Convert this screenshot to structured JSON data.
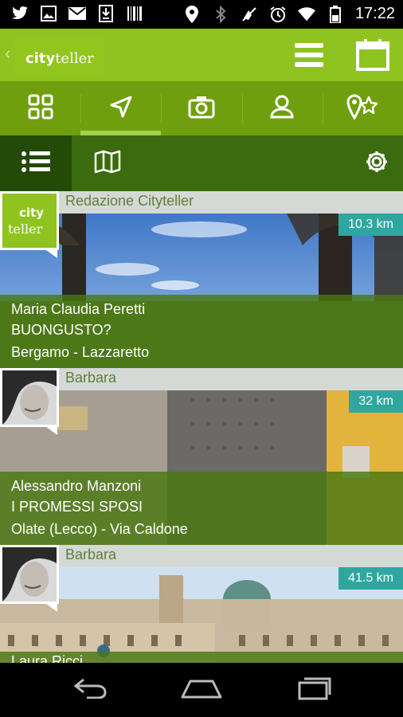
{
  "status_bar": {
    "time": "17:22",
    "icons": [
      "twitter-icon",
      "image-icon",
      "mail-icon",
      "download-icon",
      "barcode-icon",
      "location-icon",
      "bluetooth-icon",
      "mute-icon",
      "alarm-icon",
      "wifi-icon",
      "battery-icon"
    ]
  },
  "app_bar": {
    "logo_city": "city",
    "logo_teller": "teller",
    "icons": [
      "menu-icon",
      "calendar-icon"
    ]
  },
  "tabs": [
    {
      "name": "grid",
      "icon": "grid-icon",
      "active": false
    },
    {
      "name": "navigate",
      "icon": "navigation-arrow-icon",
      "active": true
    },
    {
      "name": "camera",
      "icon": "camera-icon",
      "active": false
    },
    {
      "name": "profile",
      "icon": "user-icon",
      "active": false
    },
    {
      "name": "favorites",
      "icon": "location-star-icon",
      "active": false
    }
  ],
  "sub_tabs": {
    "list_icon": "list-icon",
    "map_icon": "map-icon",
    "settings_icon": "gear-icon"
  },
  "cards": [
    {
      "author": "Redazione Cityteller",
      "distance": "10.3 km",
      "lines": [
        "Maria Claudia Peretti",
        "BUONGUSTO?",
        "Bergamo - Lazzaretto"
      ],
      "avatar_text_1": "city",
      "avatar_text_2": "teller"
    },
    {
      "author": "Barbara",
      "distance": "32 km",
      "lines": [
        "Alessandro Manzoni",
        "I PROMESSI SPOSI",
        "Olate (Lecco) - Via Caldone"
      ]
    },
    {
      "author": "Barbara",
      "distance": "41.5 km",
      "lines": [
        "Laura Ricci"
      ]
    }
  ],
  "colors": {
    "brand_green": "#8fc31f",
    "tab_green": "#6f9f0e",
    "dark_green": "#3c6a0e",
    "distance_badge": "#2fa7a0"
  }
}
